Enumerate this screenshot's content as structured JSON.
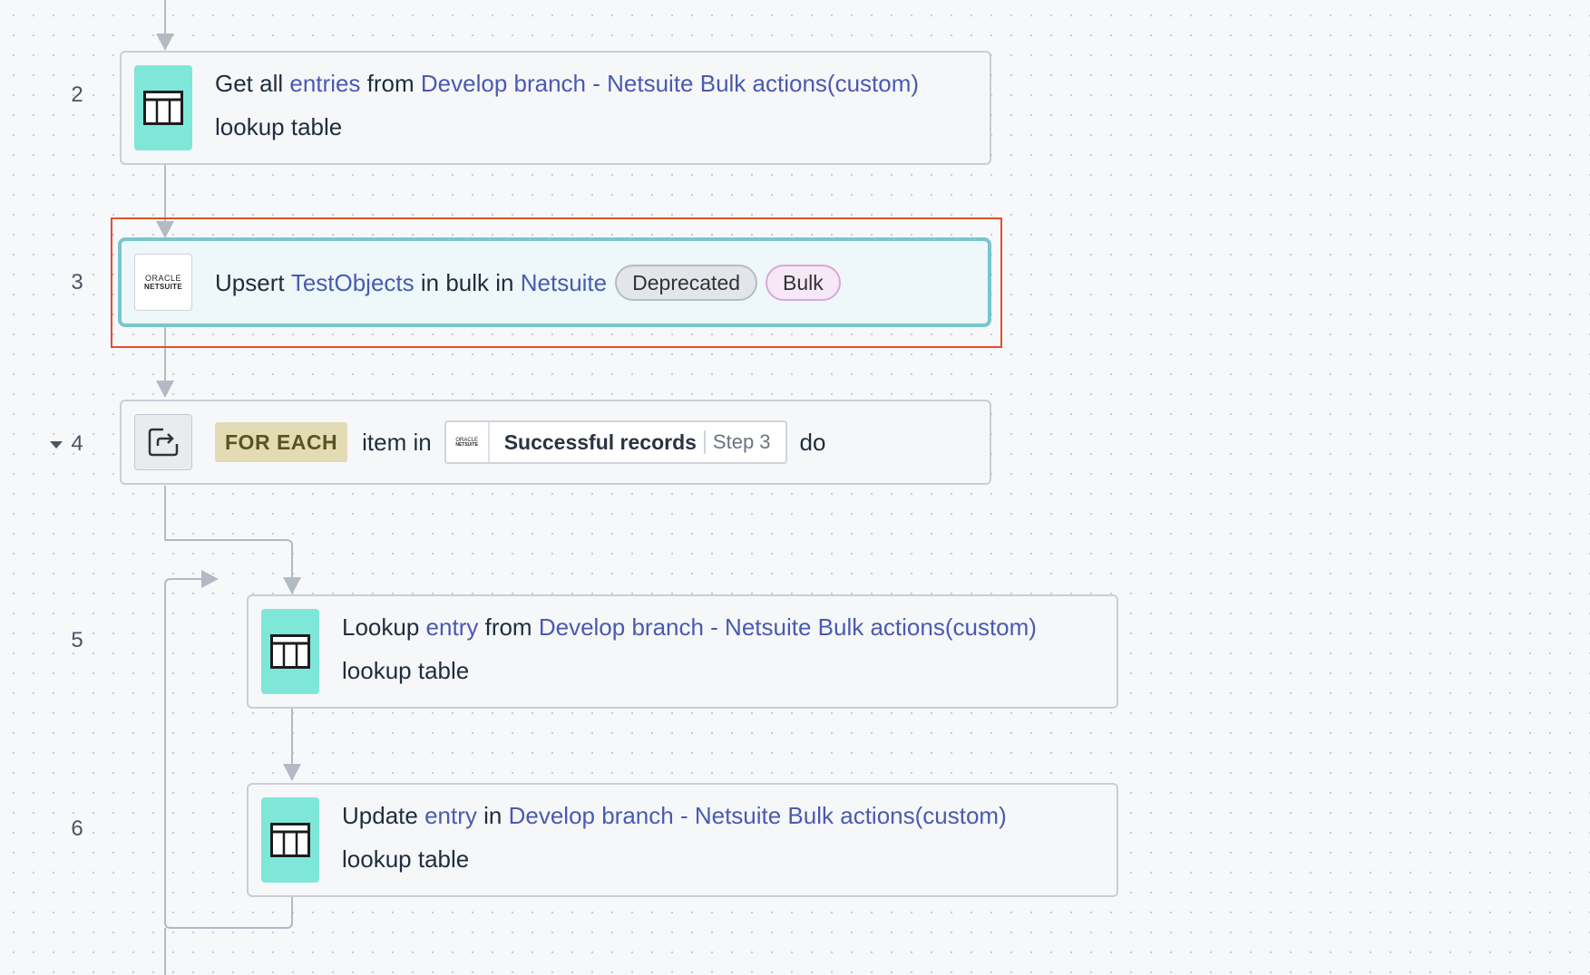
{
  "steps": {
    "s2": {
      "number": "2",
      "verb": "Get all",
      "object": "entries",
      "preposition": "from",
      "target": "Develop branch - Netsuite Bulk actions(custom)",
      "suffix": "lookup table",
      "icon": "table-icon"
    },
    "s3": {
      "number": "3",
      "verb": "Upsert",
      "object": "TestObjects",
      "preposition": "in bulk in",
      "target": "Netsuite",
      "badges": [
        "Deprecated",
        "Bulk"
      ],
      "icon": "oracle-netsuite-logo",
      "logo_text_top": "ORACLE",
      "logo_text_bottom": "NETSUITE"
    },
    "s4": {
      "number": "4",
      "keyword": "FOR EACH",
      "pre_pill": "item in",
      "datapill_label": "Successful records",
      "datapill_step": "Step 3",
      "post_pill": "do",
      "icon": "loop-icon"
    },
    "s5": {
      "number": "5",
      "verb": "Lookup",
      "object": "entry",
      "preposition": "from",
      "target": "Develop branch - Netsuite Bulk actions(custom)",
      "suffix": "lookup table",
      "icon": "table-icon"
    },
    "s6": {
      "number": "6",
      "verb": "Update",
      "object": "entry",
      "preposition": "in",
      "target": "Develop branch - Netsuite Bulk actions(custom)",
      "suffix": "lookup table",
      "icon": "table-icon"
    }
  },
  "colors": {
    "link": "#4a5ab0",
    "table_icon_bg": "#7fe6da",
    "selected_border": "#79c6cc",
    "highlight_frame": "#e0512c",
    "foreach_bg": "#e2dbb4",
    "connector": "#b3bac4"
  }
}
